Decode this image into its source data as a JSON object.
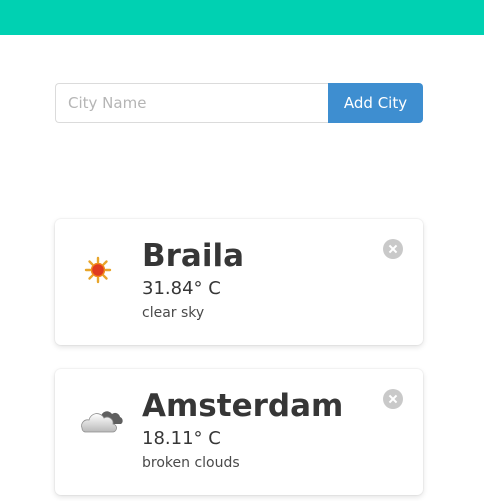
{
  "form": {
    "placeholder": "City Name",
    "value": "",
    "add_button_label": "Add City"
  },
  "colors": {
    "topbar": "#00d1b2",
    "button": "#3e8ed0",
    "delete": "#c9c9c9"
  },
  "cities": [
    {
      "name": "Braila",
      "temperature": "31.84° C",
      "description": "clear sky",
      "icon": "sun-icon"
    },
    {
      "name": "Amsterdam",
      "temperature": "18.11° C",
      "description": "broken clouds",
      "icon": "cloud-icon"
    }
  ]
}
